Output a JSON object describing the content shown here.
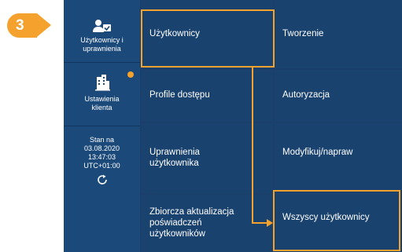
{
  "callout": {
    "step_number": "3"
  },
  "sidebar": {
    "users": {
      "label": "Użytkownicy i uprawnienia",
      "icon": "users-check-icon"
    },
    "client": {
      "label": "Ustawienia klienta",
      "icon": "building-icon",
      "badge_color": "#f4a12e"
    },
    "status": {
      "line1": "Stan na",
      "date": "03.08.2020",
      "time": "13:47:03",
      "timezone": "UTC+01:00",
      "icon": "refresh-icon"
    }
  },
  "menu": {
    "col1": [
      "Użytkownicy",
      "Profile dostępu",
      "Uprawnienia użytkownika",
      "Zbiorcza aktualizacja poświadczeń użytkowników"
    ],
    "col2": [
      "Tworzenie",
      "Autoryzacja",
      "Modyfikuj/napraw",
      "Wszyscy użytkownicy"
    ]
  },
  "colors": {
    "accent": "#f4a12e",
    "panel": "#1a426f",
    "sidebar": "#1b4979"
  }
}
